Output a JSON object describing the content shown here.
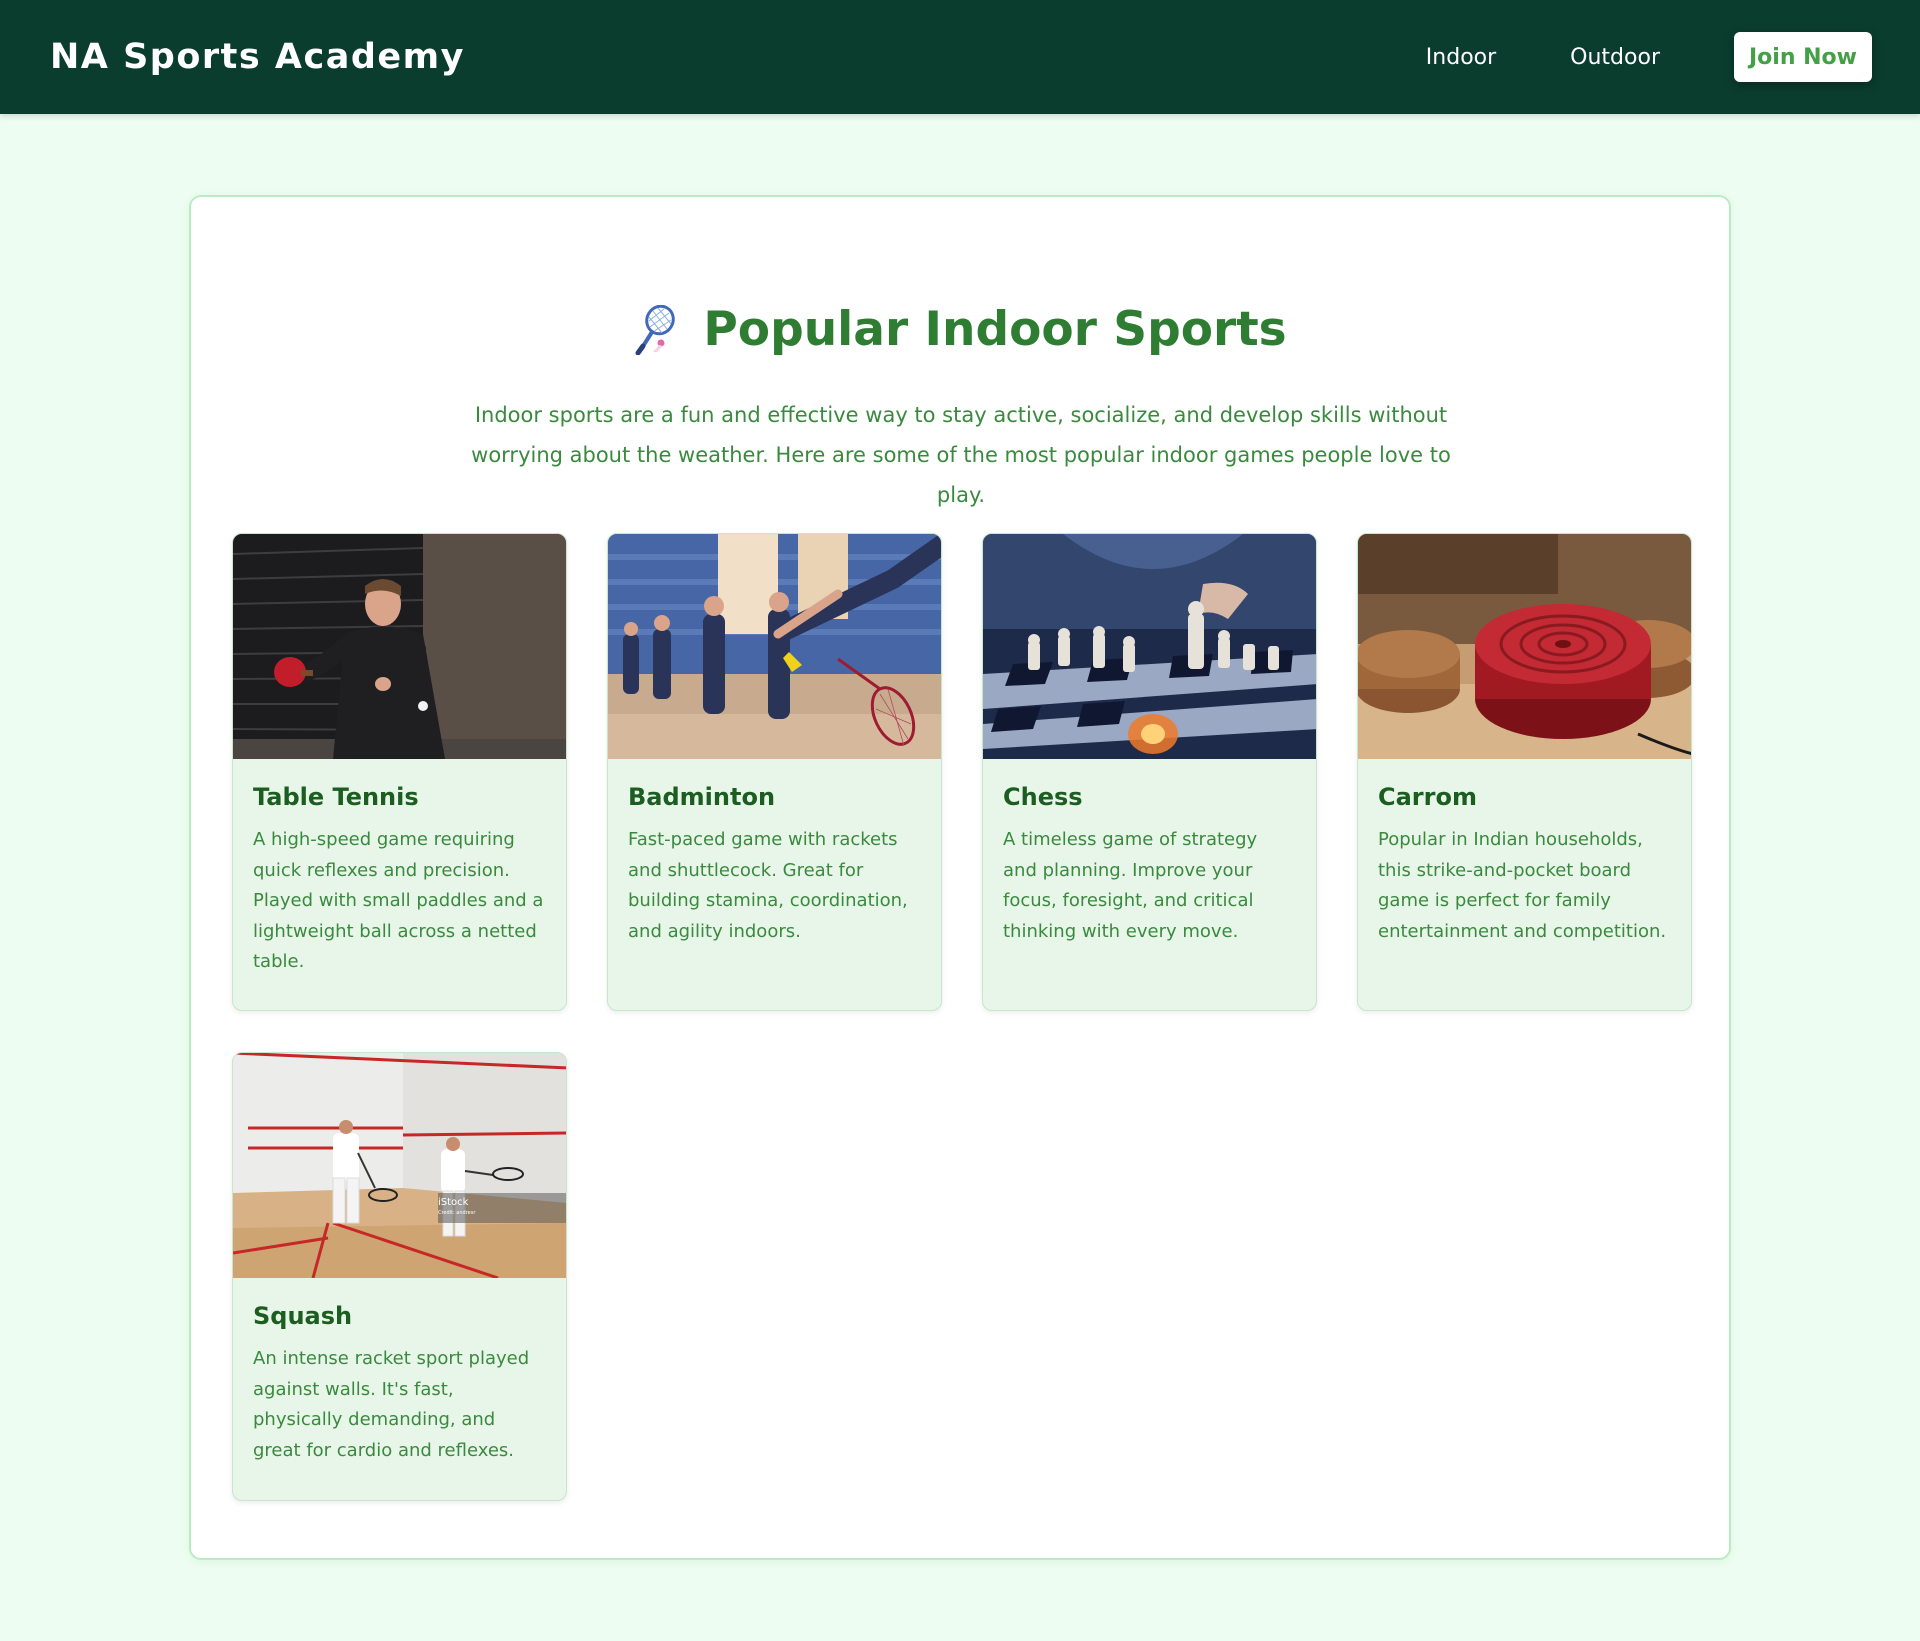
{
  "nav": {
    "brand": "NA Sports Academy",
    "links": [
      "Indoor",
      "Outdoor"
    ],
    "join_label": "Join Now"
  },
  "main": {
    "icon": "badminton-racket-icon",
    "title": "Popular Indoor Sports",
    "intro": "Indoor sports are a fun and effective way to stay active, socialize, and develop skills without worrying about the weather. Here are some of the most popular indoor games people love to play."
  },
  "cards": [
    {
      "title": "Table Tennis",
      "text": "A high-speed game requiring quick reflexes and precision. Played with small paddles and a lightweight ball across a netted table.",
      "image": "table-tennis-player-photo"
    },
    {
      "title": "Badminton",
      "text": "Fast-paced game with rackets and shuttlecock. Great for building stamina, coordination, and agility indoors.",
      "image": "badminton-players-photo"
    },
    {
      "title": "Chess",
      "text": "A timeless game of strategy and planning. Improve your focus, foresight, and critical thinking with every move.",
      "image": "chess-board-photo"
    },
    {
      "title": "Carrom",
      "text": "Popular in Indian households, this strike-and-pocket board game is perfect for family entertainment and competition.",
      "image": "carrom-striker-photo"
    },
    {
      "title": "Squash",
      "text": "An intense racket sport played against walls. It's fast, physically demanding, and great for cardio and reflexes.",
      "image": "squash-court-photo",
      "watermark": "iStock",
      "watermark_sub": "Credit: andresr"
    }
  ],
  "colors": {
    "nav_bg": "#0a3d2e",
    "page_bg": "#edfdf1",
    "accent": "#2e7d32",
    "card_bg": "#e8f5e9"
  }
}
